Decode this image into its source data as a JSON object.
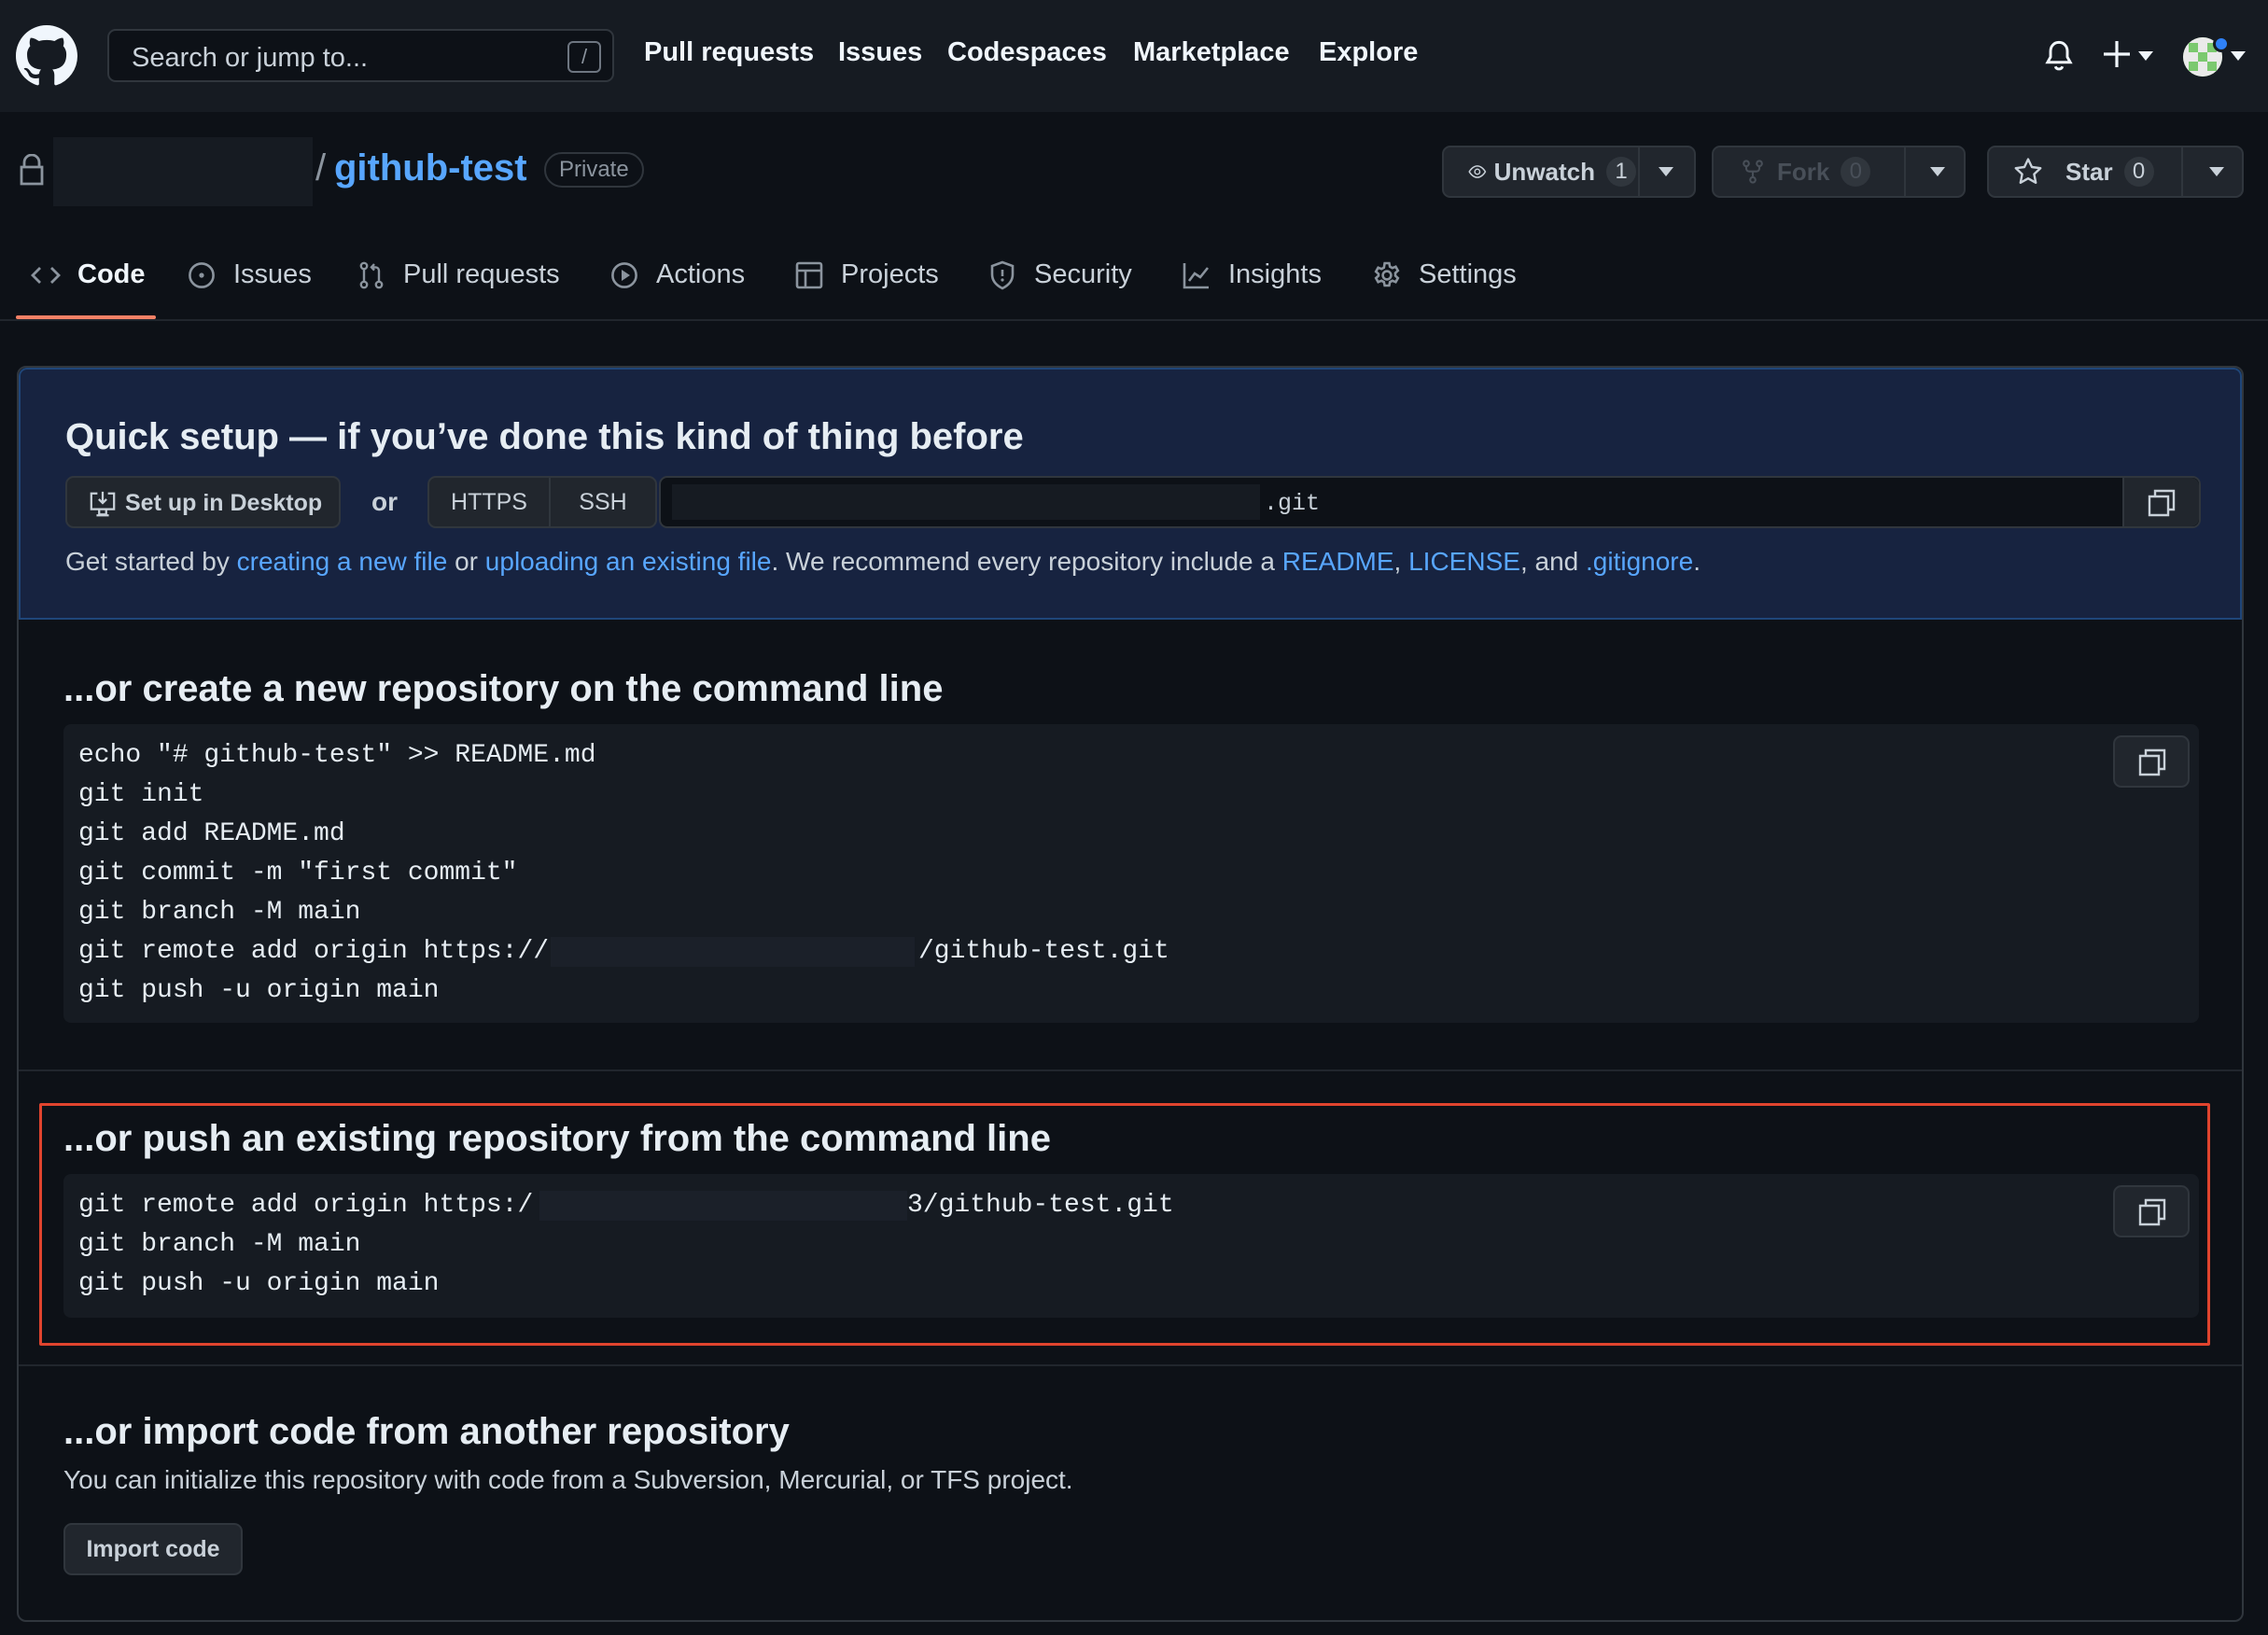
{
  "header": {
    "search_placeholder": "Search or jump to...",
    "search_shortcut": "/",
    "nav": [
      "Pull requests",
      "Issues",
      "Codespaces",
      "Marketplace",
      "Explore"
    ]
  },
  "repo": {
    "separator": "/",
    "name": "github-test",
    "visibility": "Private",
    "watch": {
      "label": "Unwatch",
      "count": "1"
    },
    "fork": {
      "label": "Fork",
      "count": "0"
    },
    "star": {
      "label": "Star",
      "count": "0"
    }
  },
  "tabs": [
    {
      "label": "Code",
      "icon": "code-icon"
    },
    {
      "label": "Issues",
      "icon": "issue-icon"
    },
    {
      "label": "Pull requests",
      "icon": "pull-request-icon"
    },
    {
      "label": "Actions",
      "icon": "play-icon"
    },
    {
      "label": "Projects",
      "icon": "table-icon"
    },
    {
      "label": "Security",
      "icon": "shield-icon"
    },
    {
      "label": "Insights",
      "icon": "graph-icon"
    },
    {
      "label": "Settings",
      "icon": "gear-icon"
    }
  ],
  "quick_setup": {
    "title": "Quick setup — if you’ve done this kind of thing before",
    "desktop_label": "Set up in Desktop",
    "or": "or",
    "https": "HTTPS",
    "ssh": "SSH",
    "url_suffix": ".git",
    "text_start": "Get started by ",
    "link_create": "creating a new file",
    "text_or": " or ",
    "link_upload": "uploading an existing file",
    "text_mid": ". We recommend every repository include a ",
    "link_readme": "README",
    "text_comma": ", ",
    "link_license": "LICENSE",
    "text_and": ", and ",
    "link_gitignore": ".gitignore",
    "text_end": "."
  },
  "create_section": {
    "title": "...or create a new repository on the command line",
    "lines": [
      "echo \"# github-test\" >> README.md",
      "git init",
      "git add README.md",
      "git commit -m \"first commit\"",
      "git branch -M main",
      "git remote add origin https://",
      "git push -u origin main"
    ],
    "remote_suffix": "/github-test.git"
  },
  "push_section": {
    "title": "...or push an existing repository from the command line",
    "lines": [
      "git remote add origin https:/",
      "git branch -M main",
      "git push -u origin main"
    ],
    "remote_suffix": "3/github-test.git"
  },
  "import_section": {
    "title": "...or import code from another repository",
    "text": "You can initialize this repository with code from a Subversion, Mercurial, or TFS project.",
    "button": "Import code"
  },
  "colors": {
    "accent": "#58a6ff",
    "tab_underline": "#f78166",
    "highlight_box": "#e0442e"
  }
}
